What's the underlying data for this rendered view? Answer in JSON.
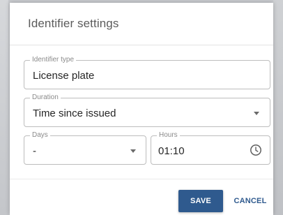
{
  "dialog": {
    "title": "Identifier settings"
  },
  "form": {
    "identifier_type": {
      "label": "Identifier type",
      "value": "License plate"
    },
    "duration": {
      "label": "Duration",
      "value": "Time since issued"
    },
    "days": {
      "label": "Days",
      "value": "-"
    },
    "hours": {
      "label": "Hours",
      "value": "01:10"
    }
  },
  "actions": {
    "save_label": "SAVE",
    "cancel_label": "CANCEL"
  },
  "colors": {
    "primary": "#2f5a8e",
    "border": "#bdbdbd",
    "label": "#8a8a8a"
  },
  "icons": {
    "dropdown": "chevron-down-icon",
    "time": "clock-icon"
  }
}
